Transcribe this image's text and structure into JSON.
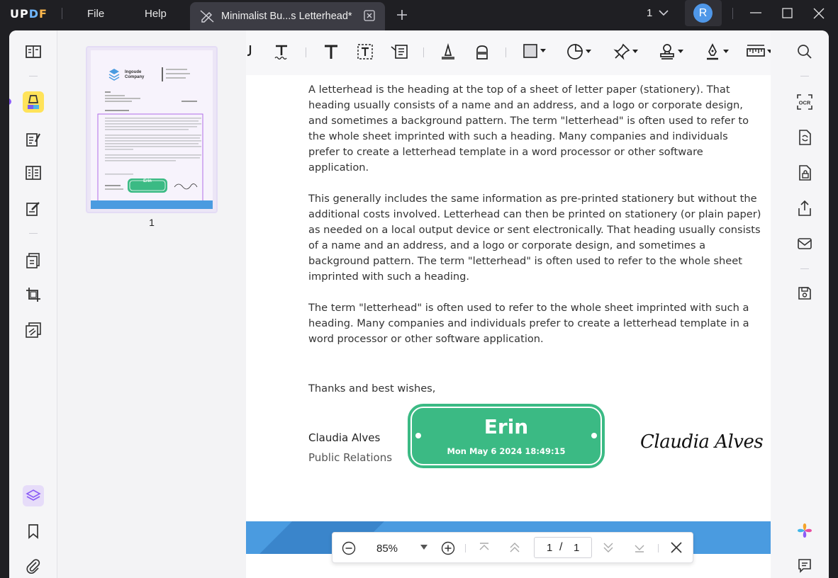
{
  "app": {
    "logo": {
      "u": "U",
      "p": "P",
      "d": "D",
      "f": "F"
    }
  },
  "menu": {
    "file": "File",
    "help": "Help"
  },
  "tab": {
    "title": "Minimalist Bu...s Letterhead*",
    "icon": "edit-off-icon"
  },
  "titlebar": {
    "page_count": "1",
    "avatar_letter": "R",
    "avatar_color": "#4f97e8"
  },
  "thumbnails": [
    {
      "page_number": "1"
    }
  ],
  "document": {
    "paragraphs": [
      "A letterhead is the heading at the top of a sheet of letter paper (stationery). That heading usually consists of a name and an address, and a logo or corporate design, and sometimes a background pattern. The term \"letterhead\" is often used to refer to the whole sheet imprinted with such a heading. Many companies and individuals prefer to create a letterhead template in a word processor or other software application.",
      "This generally includes the same information as pre-printed stationery but without the additional costs involved. Letterhead can then be printed on stationery (or plain paper) as needed on a local output device or sent electronically. That heading usually consists of a name and an address, and a logo or corporate design, and sometimes a background pattern. The term \"letterhead\" is often used to refer to the whole sheet imprinted with such a heading.",
      "The term \"letterhead\" is often used to refer to the whole sheet imprinted with such a heading. Many companies and individuals prefer to create a letterhead template in a word processor or other software application."
    ],
    "closing": "Thanks and best wishes,",
    "sender_name": "Claudia Alves",
    "sender_role": "Public Relations",
    "signature": "Claudia Alves",
    "stamp": {
      "name": "Erin",
      "date": "Mon May 6 2024 18:49:15",
      "color": "#3bba84"
    },
    "thumb_company": {
      "line1": "Ingoude",
      "line2": "Company"
    },
    "thumb_stamp_name": "Erin"
  },
  "zoombar": {
    "zoom": "85%",
    "current_page": "1",
    "separator": "/",
    "total_pages": "1"
  },
  "colors": {
    "accent": "#8a5cf6",
    "highlight": "#ffe35a",
    "footer_blue": "#4a9be0"
  }
}
